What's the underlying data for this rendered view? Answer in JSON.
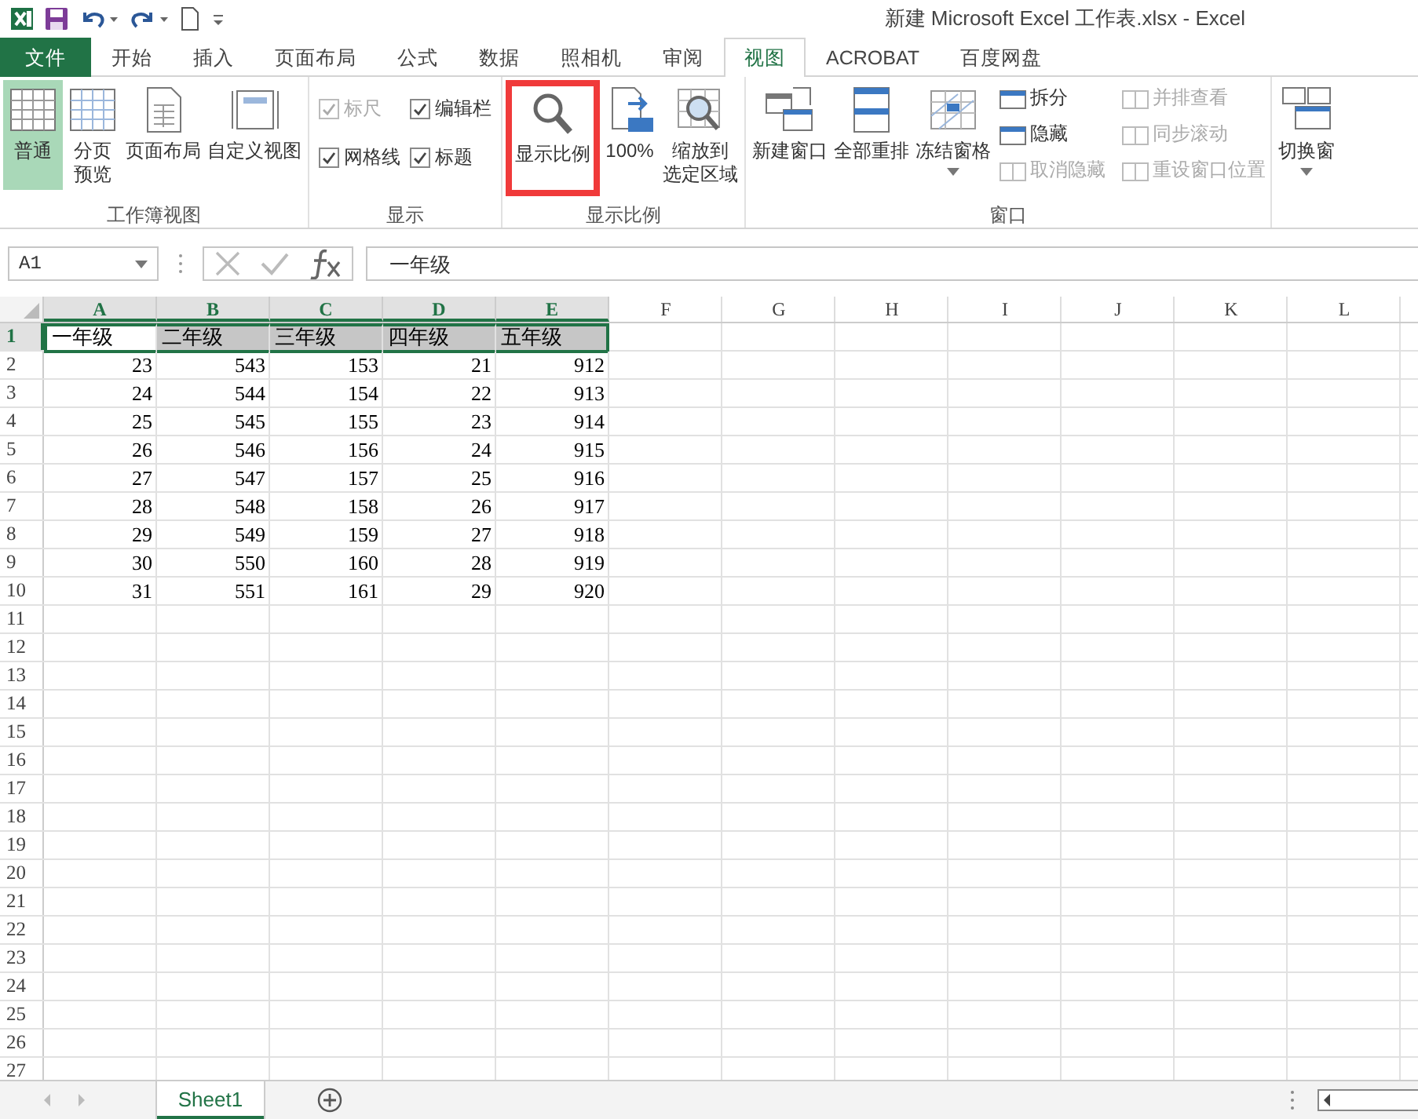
{
  "title_bar": {
    "title": "新建 Microsoft Excel 工作表.xlsx - Excel"
  },
  "tabs": [
    {
      "label": "文件",
      "kind": "file",
      "selected": false
    },
    {
      "label": "开始",
      "kind": "tab",
      "selected": false
    },
    {
      "label": "插入",
      "kind": "tab",
      "selected": false
    },
    {
      "label": "页面布局",
      "kind": "tab",
      "selected": false
    },
    {
      "label": "公式",
      "kind": "tab",
      "selected": false
    },
    {
      "label": "数据",
      "kind": "tab",
      "selected": false
    },
    {
      "label": "照相机",
      "kind": "tab",
      "selected": false
    },
    {
      "label": "审阅",
      "kind": "tab",
      "selected": false
    },
    {
      "label": "视图",
      "kind": "tab",
      "selected": true
    },
    {
      "label": "ACROBAT",
      "kind": "tab",
      "selected": false
    },
    {
      "label": "百度网盘",
      "kind": "tab",
      "selected": false
    }
  ],
  "ribbon": {
    "groups": [
      {
        "label": "工作簿视图",
        "items": [
          {
            "lines": [
              "普通"
            ],
            "selected": true,
            "highlighted": false
          },
          {
            "lines": [
              "分页",
              "预览"
            ],
            "selected": false,
            "highlighted": false
          },
          {
            "lines": [
              "页面布局"
            ],
            "selected": false,
            "highlighted": false
          },
          {
            "lines": [
              "自定义视图"
            ],
            "selected": false,
            "highlighted": false
          }
        ]
      },
      {
        "label": "显示",
        "checkboxes": [
          {
            "label": "标尺",
            "checked": true,
            "disabled": true
          },
          {
            "label": "编辑栏",
            "checked": true,
            "disabled": false
          },
          {
            "label": "网格线",
            "checked": true,
            "disabled": false
          },
          {
            "label": "标题",
            "checked": true,
            "disabled": false
          }
        ]
      },
      {
        "label": "显示比例",
        "items": [
          {
            "lines": [
              "显示比例"
            ],
            "selected": false,
            "highlighted": true
          },
          {
            "lines": [
              "100%"
            ],
            "selected": false,
            "highlighted": false
          },
          {
            "lines": [
              "缩放到",
              "选定区域"
            ],
            "selected": false,
            "highlighted": false
          }
        ]
      },
      {
        "label": "窗口",
        "items": [
          {
            "lines": [
              "新建窗口"
            ],
            "selected": false,
            "highlighted": false
          },
          {
            "lines": [
              "全部重排"
            ],
            "selected": false,
            "highlighted": false
          },
          {
            "lines": [
              "冻结窗格"
            ],
            "selected": false,
            "highlighted": false,
            "dropdown": true
          }
        ],
        "small": [
          {
            "label": "拆分",
            "disabled": false
          },
          {
            "label": "隐藏",
            "disabled": false
          },
          {
            "label": "取消隐藏",
            "disabled": true
          },
          {
            "label": "并排查看",
            "disabled": true
          },
          {
            "label": "同步滚动",
            "disabled": true
          },
          {
            "label": "重设窗口位置",
            "disabled": true
          }
        ]
      },
      {
        "items": [
          {
            "lines": [
              "切换窗"
            ],
            "selected": false,
            "highlighted": false,
            "dropdown": true
          }
        ]
      }
    ]
  },
  "formula_bar": {
    "name_box": "A1",
    "formula": "一年级"
  },
  "sheet": {
    "columns": [
      {
        "label": "A",
        "selected": true
      },
      {
        "label": "B",
        "selected": true
      },
      {
        "label": "C",
        "selected": true
      },
      {
        "label": "D",
        "selected": true
      },
      {
        "label": "E",
        "selected": true
      },
      {
        "label": "F",
        "selected": false
      },
      {
        "label": "G",
        "selected": false
      },
      {
        "label": "H",
        "selected": false
      },
      {
        "label": "I",
        "selected": false
      },
      {
        "label": "J",
        "selected": false
      },
      {
        "label": "K",
        "selected": false
      },
      {
        "label": "L",
        "selected": false
      }
    ],
    "rows": [
      {
        "label": "1",
        "selected": true,
        "kind": "text",
        "cells": [
          "一年级",
          "二年级",
          "三年级",
          "四年级",
          "五年级"
        ]
      },
      {
        "label": "2",
        "selected": false,
        "kind": "number",
        "cells": [
          "23",
          "543",
          "153",
          "21",
          "912"
        ]
      },
      {
        "label": "3",
        "selected": false,
        "kind": "number",
        "cells": [
          "24",
          "544",
          "154",
          "22",
          "913"
        ]
      },
      {
        "label": "4",
        "selected": false,
        "kind": "number",
        "cells": [
          "25",
          "545",
          "155",
          "23",
          "914"
        ]
      },
      {
        "label": "5",
        "selected": false,
        "kind": "number",
        "cells": [
          "26",
          "546",
          "156",
          "24",
          "915"
        ]
      },
      {
        "label": "6",
        "selected": false,
        "kind": "number",
        "cells": [
          "27",
          "547",
          "157",
          "25",
          "916"
        ]
      },
      {
        "label": "7",
        "selected": false,
        "kind": "number",
        "cells": [
          "28",
          "548",
          "158",
          "26",
          "917"
        ]
      },
      {
        "label": "8",
        "selected": false,
        "kind": "number",
        "cells": [
          "29",
          "549",
          "159",
          "27",
          "918"
        ]
      },
      {
        "label": "9",
        "selected": false,
        "kind": "number",
        "cells": [
          "30",
          "550",
          "160",
          "28",
          "919"
        ]
      },
      {
        "label": "10",
        "selected": false,
        "kind": "number",
        "cells": [
          "31",
          "551",
          "161",
          "29",
          "920"
        ]
      },
      {
        "label": "11",
        "selected": false
      },
      {
        "label": "12",
        "selected": false
      },
      {
        "label": "13",
        "selected": false
      },
      {
        "label": "14",
        "selected": false
      },
      {
        "label": "15",
        "selected": false
      },
      {
        "label": "16",
        "selected": false
      },
      {
        "label": "17",
        "selected": false
      },
      {
        "label": "18",
        "selected": false
      },
      {
        "label": "19",
        "selected": false
      },
      {
        "label": "20",
        "selected": false
      },
      {
        "label": "21",
        "selected": false
      },
      {
        "label": "22",
        "selected": false
      },
      {
        "label": "23",
        "selected": false
      },
      {
        "label": "24",
        "selected": false
      },
      {
        "label": "25",
        "selected": false
      },
      {
        "label": "26",
        "selected": false
      },
      {
        "label": "27",
        "selected": false
      }
    ]
  },
  "sheet_tabs": [
    {
      "label": "Sheet1",
      "selected": true
    }
  ]
}
